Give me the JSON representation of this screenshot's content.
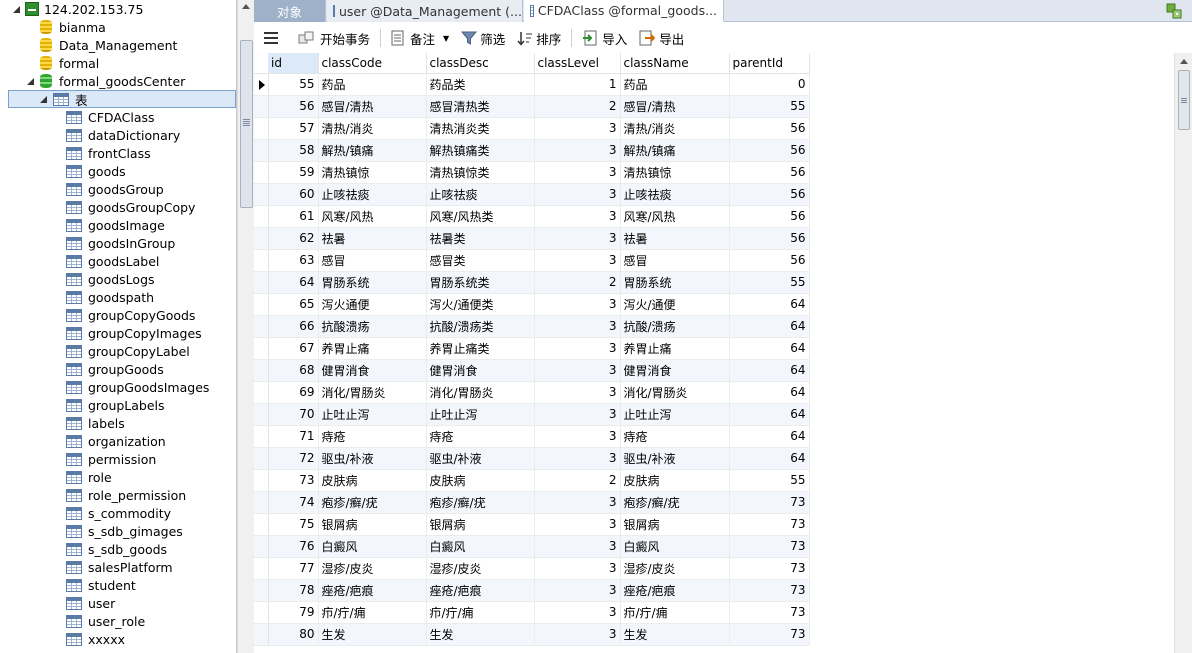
{
  "tree": {
    "server": "124.202.153.75",
    "databases": [
      "bianma",
      "Data_Management",
      "formal"
    ],
    "open_db": "formal_goodsCenter",
    "tables_folder": "表",
    "tables": [
      "CFDAClass",
      "dataDictionary",
      "frontClass",
      "goods",
      "goodsGroup",
      "goodsGroupCopy",
      "goodsImage",
      "goodsInGroup",
      "goodsLabel",
      "goodsLogs",
      "goodspath",
      "groupCopyGoods",
      "groupCopyImages",
      "groupCopyLabel",
      "groupGoods",
      "groupGoodsImages",
      "groupLabels",
      "labels",
      "organization",
      "permission",
      "role",
      "role_permission",
      "s_commodity",
      "s_sdb_gimages",
      "s_sdb_goods",
      "salesPlatform",
      "student",
      "user",
      "user_role",
      "xxxxx"
    ]
  },
  "tabs": {
    "objects": "对象",
    "tab1": "user @Data_Management (...",
    "tab2": "CFDAClass @formal_goods..."
  },
  "toolbar": {
    "begin_tx": "开始事务",
    "memo": "备注",
    "filter": "筛选",
    "sort": "排序",
    "import": "导入",
    "export": "导出"
  },
  "grid": {
    "columns": [
      "id",
      "classCode",
      "classDesc",
      "classLevel",
      "className",
      "parentId"
    ],
    "rows": [
      [
        "55",
        "药品",
        "药品类",
        "1",
        "药品",
        "0"
      ],
      [
        "56",
        "感冒/清热",
        "感冒清热类",
        "2",
        "感冒/清热",
        "55"
      ],
      [
        "57",
        "清热/消炎",
        "清热消炎类",
        "3",
        "清热/消炎",
        "56"
      ],
      [
        "58",
        "解热/镇痛",
        "解热镇痛类",
        "3",
        "解热/镇痛",
        "56"
      ],
      [
        "59",
        "清热镇惊",
        "清热镇惊类",
        "3",
        "清热镇惊",
        "56"
      ],
      [
        "60",
        "止咳祛痰",
        "止咳祛痰",
        "3",
        "止咳祛痰",
        "56"
      ],
      [
        "61",
        "风寒/风热",
        "风寒/风热类",
        "3",
        "风寒/风热",
        "56"
      ],
      [
        "62",
        "祛暑",
        "祛暑类",
        "3",
        "祛暑",
        "56"
      ],
      [
        "63",
        "感冒",
        "感冒类",
        "3",
        "感冒",
        "56"
      ],
      [
        "64",
        "胃肠系统",
        "胃肠系统类",
        "2",
        "胃肠系统",
        "55"
      ],
      [
        "65",
        "泻火通便",
        "泻火/通便类",
        "3",
        "泻火/通便",
        "64"
      ],
      [
        "66",
        "抗酸溃疡",
        "抗酸/溃疡类",
        "3",
        "抗酸/溃疡",
        "64"
      ],
      [
        "67",
        "养胃止痛",
        "养胃止痛类",
        "3",
        "养胃止痛",
        "64"
      ],
      [
        "68",
        "健胃消食",
        "健胃消食",
        "3",
        "健胃消食",
        "64"
      ],
      [
        "69",
        "消化/胃肠炎",
        "消化/胃肠炎",
        "3",
        "消化/胃肠炎",
        "64"
      ],
      [
        "70",
        "止吐止泻",
        "止吐止泻",
        "3",
        "止吐止泻",
        "64"
      ],
      [
        "71",
        "痔疮",
        "痔疮",
        "3",
        "痔疮",
        "64"
      ],
      [
        "72",
        "驱虫/补液",
        "驱虫/补液",
        "3",
        "驱虫/补液",
        "64"
      ],
      [
        "73",
        "皮肤病",
        "皮肤病",
        "2",
        "皮肤病",
        "55"
      ],
      [
        "74",
        "疱疹/癣/疣",
        "疱疹/癣/疣",
        "3",
        "疱疹/癣/疣",
        "73"
      ],
      [
        "75",
        "银屑病",
        "银屑病",
        "3",
        "银屑病",
        "73"
      ],
      [
        "76",
        "白癜风",
        "白癜风",
        "3",
        "白癜风",
        "73"
      ],
      [
        "77",
        "湿疹/皮炎",
        "湿疹/皮炎",
        "3",
        "湿疹/皮炎",
        "73"
      ],
      [
        "78",
        "痤疮/疤痕",
        "痤疮/疤痕",
        "3",
        "痤疮/疤痕",
        "73"
      ],
      [
        "79",
        "疖/疔/痈",
        "疖/疔/痈",
        "3",
        "疖/疔/痈",
        "73"
      ],
      [
        "80",
        "生发",
        "生发",
        "3",
        "生发",
        "73"
      ]
    ]
  }
}
